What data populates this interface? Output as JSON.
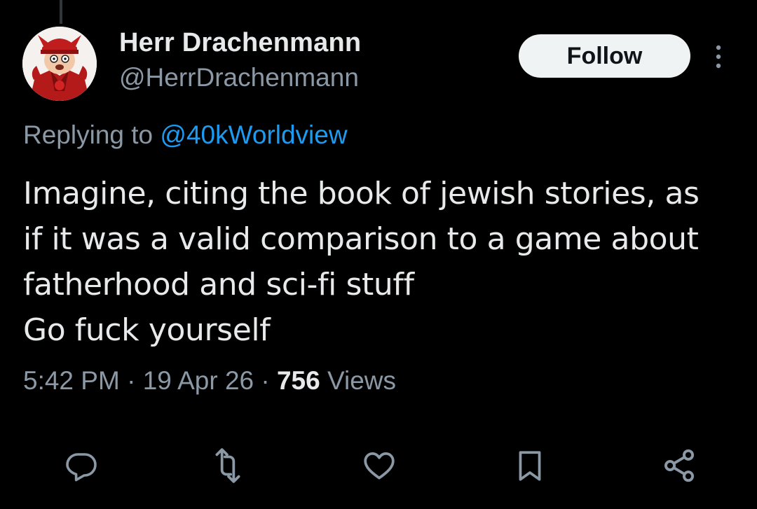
{
  "tweet": {
    "author": {
      "display_name": "Herr Drachenmann",
      "handle": "@HerrDrachenmann"
    },
    "follow_label": "Follow",
    "replying_prefix": "Replying to ",
    "replying_to": "@40kWorldview",
    "text_lines": [
      "Imagine, citing the book of jewish stories, as",
      "if it was a valid comparison to a game about",
      "fatherhood and sci-fi stuff",
      "Go fuck yourself"
    ],
    "time": "5:42 PM",
    "date": "19 Apr 26",
    "separator": " · ",
    "views_count": "756",
    "views_label": " Views"
  },
  "actions": [
    "reply-icon",
    "retweet-icon",
    "like-icon",
    "bookmark-icon",
    "share-icon"
  ],
  "colors": {
    "background": "#000000",
    "primary_text": "#e7e9ea",
    "secondary_text": "#8b98a5",
    "link": "#1d9bf0",
    "follow_bg": "#eff3f4"
  }
}
